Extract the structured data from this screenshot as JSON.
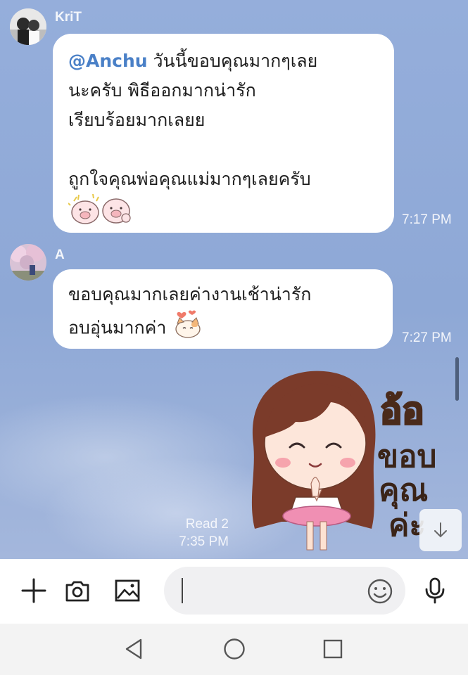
{
  "messages": [
    {
      "sender": "KriT",
      "mention": "@Anchu",
      "lines": [
        " วันนี้ขอบคุณมากๆเลย",
        "นะครับ พิธีออกมากน่ารัก",
        "เรียบร้อยมากเลยย",
        "ถูกใจคุณพ่อคุณแม่มากๆเลยครับ"
      ],
      "time": "7:17 PM"
    },
    {
      "sender": "A",
      "lines": [
        "ขอบคุณมากเลยค่างานเช้าน่ารัก",
        "อบอุ่นมากค่า"
      ],
      "time": "7:27 PM"
    }
  ],
  "sent": {
    "read_status": "Read 2",
    "time": "7:35 PM",
    "sticker_text": [
      "อ้อ",
      "ขอบ",
      "คุณ",
      "ค่ะ"
    ]
  },
  "input": {
    "placeholder": ""
  },
  "icons": {
    "add": "plus-icon",
    "camera": "camera-icon",
    "gallery": "image-icon",
    "emoji": "emoji-icon",
    "mic": "microphone-icon",
    "scroll": "arrow-down-icon",
    "back": "nav-back-icon",
    "home": "nav-home-icon",
    "recents": "nav-recents-icon"
  },
  "colors": {
    "chat_background": "#8fa9d6",
    "bubble": "#ffffff",
    "mention": "#4a80c7"
  }
}
